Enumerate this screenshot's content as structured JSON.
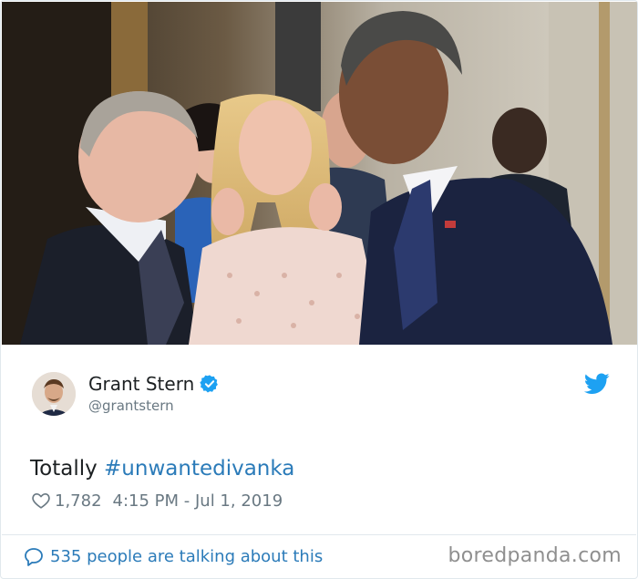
{
  "author": {
    "name": "Grant Stern",
    "handle": "@grantstern",
    "verified": true
  },
  "tweet": {
    "text_prefix": "Totally ",
    "hashtag": "#unwantedivanka",
    "like_count": "1,782",
    "timestamp": "4:15 PM - Jul 1, 2019"
  },
  "footer": {
    "talk_text": "535 people are talking about this",
    "watermark": "boredpanda.com"
  },
  "colors": {
    "link_blue": "#2b7bb9",
    "twitter_blue": "#1da1f2",
    "muted_gray": "#697882",
    "text_dark": "#1c2022"
  },
  "icons": [
    "verified-badge-icon",
    "twitter-bird-icon",
    "heart-icon",
    "speech-bubble-icon"
  ]
}
